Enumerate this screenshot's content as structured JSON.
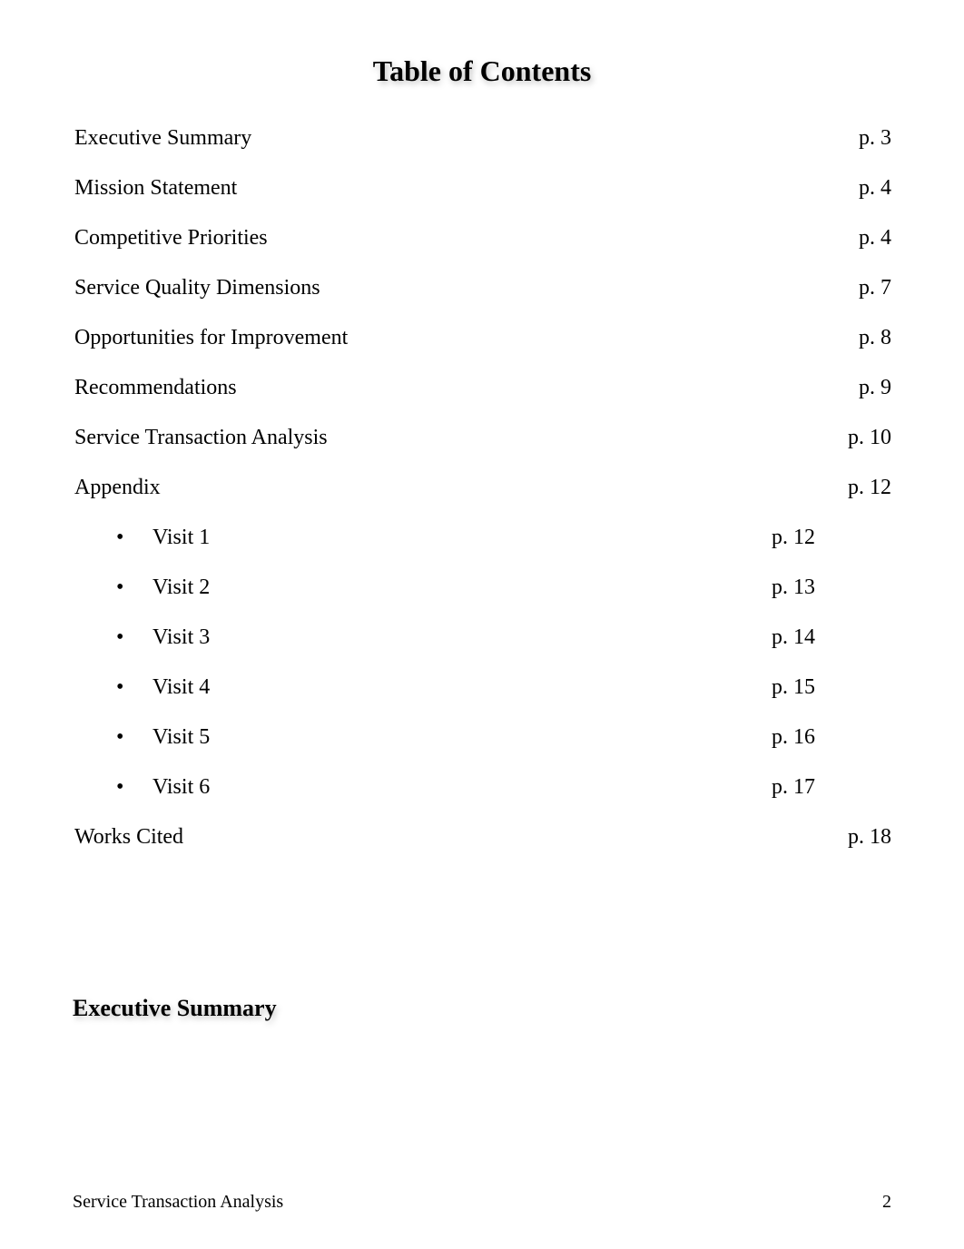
{
  "title": "Table of Contents",
  "entries": [
    {
      "label": "Executive Summary",
      "page": "p. 3"
    },
    {
      "label": "Mission Statement",
      "page": "p. 4"
    },
    {
      "label": "Competitive Priorities",
      "page": "p. 4"
    },
    {
      "label": "Service Quality Dimensions",
      "page": "p. 7"
    },
    {
      "label": "Opportunities for Improvement",
      "page": "p. 8"
    },
    {
      "label": "Recommendations",
      "page": "p. 9"
    },
    {
      "label": "Service Transaction Analysis",
      "page": "p. 10"
    },
    {
      "label": "Appendix",
      "page": "p. 12"
    }
  ],
  "appendix_items": [
    {
      "label": "Visit 1",
      "page": "p. 12"
    },
    {
      "label": "Visit 2",
      "page": "p. 13"
    },
    {
      "label": "Visit 3",
      "page": "p. 14"
    },
    {
      "label": "Visit 4",
      "page": "p. 15"
    },
    {
      "label": "Visit 5",
      "page": "p. 16"
    },
    {
      "label": "Visit 6",
      "page": "p. 17"
    }
  ],
  "works_cited": {
    "label": "Works Cited",
    "page": "p. 18"
  },
  "section_heading": "Executive Summary",
  "footer": {
    "left": "Service Transaction Analysis",
    "right": "2"
  }
}
